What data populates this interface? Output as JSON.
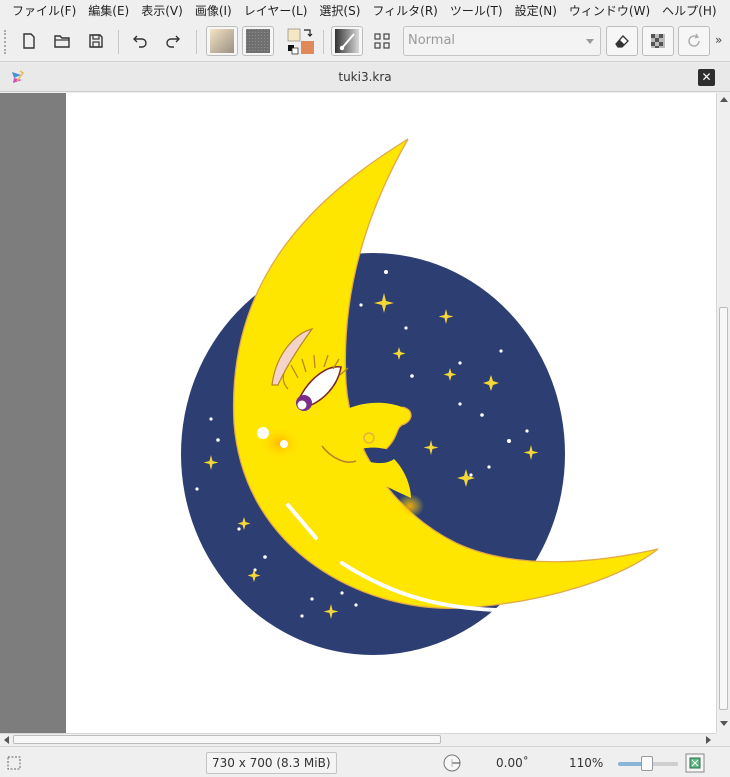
{
  "menubar": {
    "items": [
      "ファイル(F)",
      "編集(E)",
      "表示(V)",
      "画像(I)",
      "レイヤー(L)",
      "選択(S)",
      "フィルタ(R)",
      "ツール(T)",
      "設定(N)",
      "ウィンドウ(W)",
      "ヘルプ(H)"
    ]
  },
  "toolbar": {
    "blend_mode": "Normal",
    "overflow": "»",
    "icons": [
      "new-document-icon",
      "open-folder-icon",
      "save-icon",
      "undo-icon",
      "redo-icon",
      "gradient-icon",
      "pattern-icon",
      "color-swap-icon",
      "brush-preset-icon",
      "workspace-grid-icon",
      "eraser-icon",
      "alpha-lock-icon",
      "reload-icon"
    ],
    "colors": {
      "foreground": "#f5e6c4",
      "background": "#e0895a"
    }
  },
  "document": {
    "title": "tuki3.kra"
  },
  "status": {
    "image_size": "730 x 700 (8.3 MiB)",
    "rotation": "0.00˚",
    "zoom": "110%",
    "zoom_fraction": 0.5
  },
  "colors": {
    "night": "#2d3e72",
    "moon": "#ffe600",
    "moon_outline": "#e8b93a",
    "star": "#f5d836"
  }
}
